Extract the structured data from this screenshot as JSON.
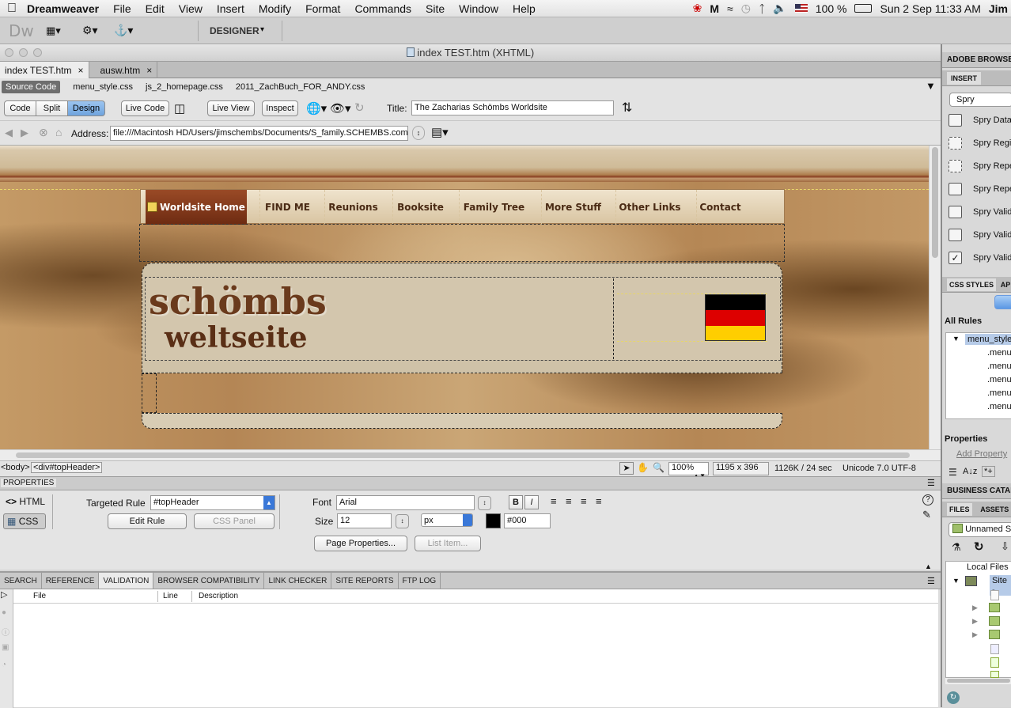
{
  "menubar": {
    "app": "Dreamweaver",
    "items": [
      "File",
      "Edit",
      "View",
      "Insert",
      "Modify",
      "Format",
      "Commands",
      "Site",
      "Window",
      "Help"
    ],
    "battery": "100 %",
    "datetime": "Sun 2 Sep  11:33 AM",
    "user": "Jim"
  },
  "apptb": {
    "logo": "Dw",
    "workspace": "DESIGNER"
  },
  "doc": {
    "window_title": "index TEST.htm (XHTML)",
    "tabs": [
      {
        "label": "index TEST.htm"
      },
      {
        "label": "ausw.htm"
      }
    ],
    "related_files": [
      "Source Code",
      "menu_style.css",
      "js_2_homepage.css",
      "2011_ZachBuch_FOR_ANDY.css"
    ]
  },
  "doctb": {
    "code": "Code",
    "split": "Split",
    "design": "Design",
    "live_code": "Live Code",
    "live_view": "Live View",
    "inspect": "Inspect",
    "title_label": "Title:",
    "title_value": "The Zacharias Schömbs Worldsite"
  },
  "browsnav": {
    "address_label": "Address:",
    "address_value": "file:///Macintosh HD/Users/jimschembs/Documents/S_family.SCHEMBS.com"
  },
  "site": {
    "nav": [
      "Worldsite Home",
      "FIND ME",
      "Reunions",
      "Booksite",
      "Family Tree",
      "More Stuff",
      "Other Links",
      "Contact"
    ],
    "logo_line1": "schömbs",
    "logo_line2": "weltseite",
    "flag_colors": [
      "#000000",
      "#dd0000",
      "#ffce00"
    ]
  },
  "status": {
    "tag_body": "<body>",
    "tag_div": "<div#topHeader>",
    "zoom": "100%",
    "dims": "1195 x 396",
    "size": "1126K / 24 sec",
    "encoding": "Unicode 7.0 UTF-8"
  },
  "props": {
    "title": "PROPERTIES",
    "html": "HTML",
    "css": "CSS",
    "targeted_rule_label": "Targeted Rule",
    "targeted_rule": "#topHeader",
    "edit_rule": "Edit Rule",
    "css_panel": "CSS Panel",
    "font_label": "Font",
    "font_value": "Arial",
    "size_label": "Size",
    "size_value": "12",
    "unit": "px",
    "color_value": "#000",
    "page_properties": "Page Properties...",
    "list_item": "List Item..."
  },
  "results": {
    "tabs": [
      "SEARCH",
      "REFERENCE",
      "VALIDATION",
      "BROWSER COMPATIBILITY",
      "LINK CHECKER",
      "SITE REPORTS",
      "FTP LOG"
    ],
    "active": "VALIDATION",
    "col_file": "File",
    "col_line": "Line",
    "col_desc": "Description"
  },
  "right": {
    "adobe_browser": "ADOBE BROWSERLAB",
    "insert": "INSERT",
    "spry_select": "Spry",
    "spry_items": [
      "Spry Data Set",
      "Spry Region",
      "Spry Repeat",
      "Spry Repeat List",
      "Spry Validation Text Field",
      "Spry Validation Textarea",
      "Spry Validation Checkbox"
    ],
    "css_styles": "CSS STYLES",
    "ap": "AP",
    "all_rules": "All Rules",
    "rule_root": "menu_style.css",
    "rules": [
      ".menu",
      ".menu",
      ".menu",
      ".menu",
      ".menu"
    ],
    "properties": "Properties",
    "add_property": "Add Property",
    "business": "BUSINESS CATALYST",
    "files": "FILES",
    "assets": "ASSETS",
    "site_select": "Unnamed Site",
    "local_files": "Local Files",
    "site_root": "Site -"
  }
}
